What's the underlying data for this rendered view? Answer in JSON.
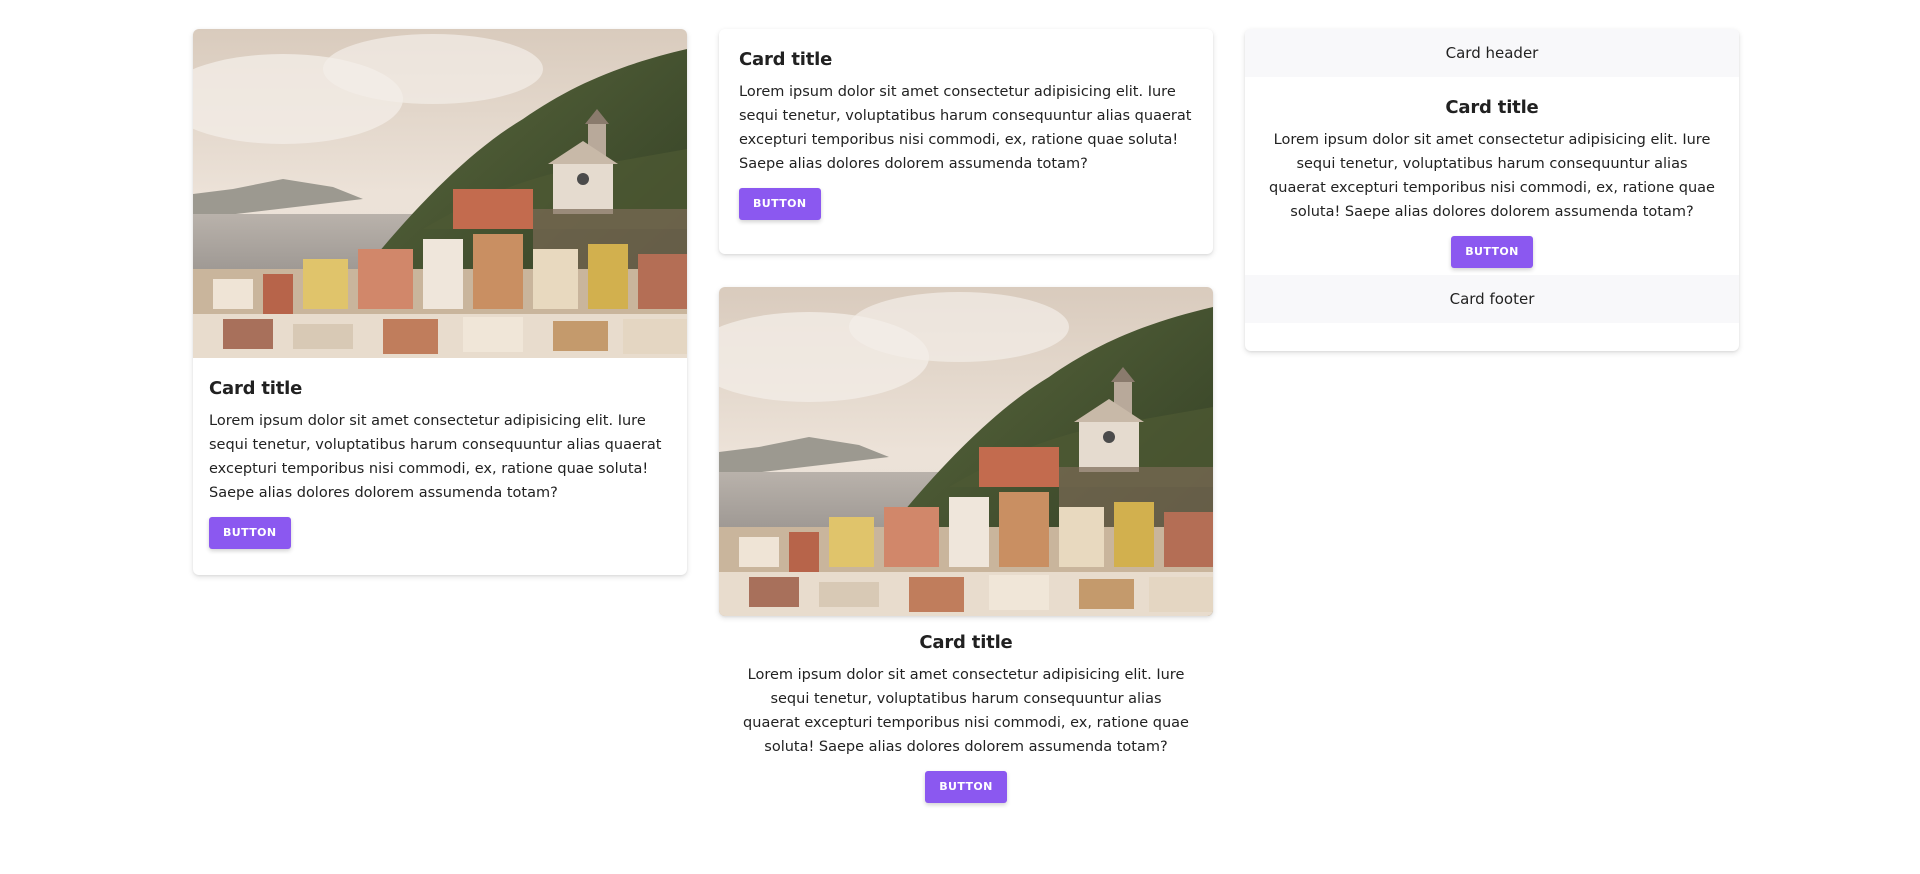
{
  "colors": {
    "accent": "#8b58f0",
    "header_bg": "#f8f8fa"
  },
  "cards": [
    {
      "title": "Card title",
      "text": "Lorem ipsum dolor sit amet consectetur adipisicing elit. Iure sequi tenetur, voluptatibus harum consequuntur alias quaerat excepturi temporibus nisi commodi, ex, ratione quae soluta! Saepe alias dolores dolorem assumenda totam?",
      "button": "Button",
      "image": "landscape-image"
    },
    {
      "title": "Card title",
      "text": "Lorem ipsum dolor sit amet consectetur adipisicing elit. Iure sequi tenetur, voluptatibus harum consequuntur alias quaerat excepturi temporibus nisi commodi, ex, ratione quae soluta! Saepe alias dolores dolorem assumenda totam?",
      "button": "Button"
    },
    {
      "title": "Card title",
      "text": "Lorem ipsum dolor sit amet consectetur adipisicing elit. Iure sequi tenetur, voluptatibus harum consequuntur alias quaerat excepturi temporibus nisi commodi, ex, ratione quae soluta! Saepe alias dolores dolorem assumenda totam?",
      "button": "Button",
      "image": "landscape-image"
    },
    {
      "header": "Card header",
      "title": "Card title",
      "text": "Lorem ipsum dolor sit amet consectetur adipisicing elit. Iure sequi tenetur, voluptatibus harum consequuntur alias quaerat excepturi temporibus nisi commodi, ex, ratione quae soluta! Saepe alias dolores dolorem assumenda totam?",
      "button": "Button",
      "footer": "Card footer"
    }
  ]
}
